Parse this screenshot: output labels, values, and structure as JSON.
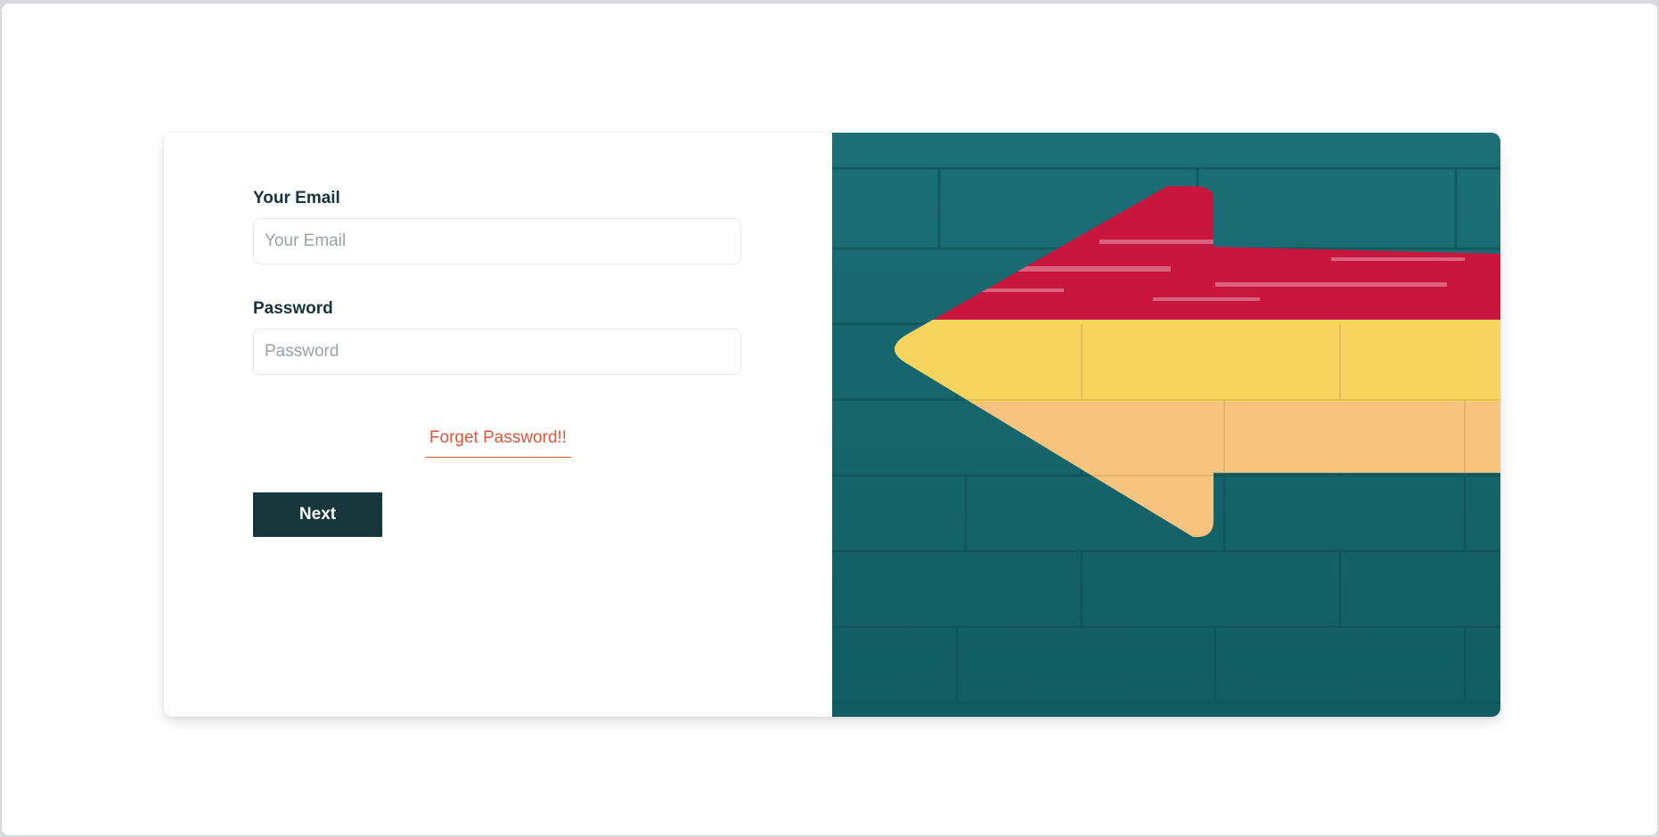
{
  "login": {
    "email_label": "Your Email",
    "email_placeholder": "Your Email",
    "email_value": "",
    "password_label": "Password",
    "password_placeholder": "Password",
    "password_value": "",
    "forgot_link": "Forget Password!!",
    "next_button": "Next"
  },
  "hero_image": {
    "subject": "painted arrow pointing left on teal brick wall",
    "colors": {
      "wall": "#14676d",
      "stripe_top": "#c8163f",
      "stripe_middle": "#f7d45e",
      "stripe_bottom": "#f6c47e"
    }
  },
  "colors": {
    "primary": "#16363b",
    "accent": "#e2553b",
    "label": "#16343a"
  }
}
